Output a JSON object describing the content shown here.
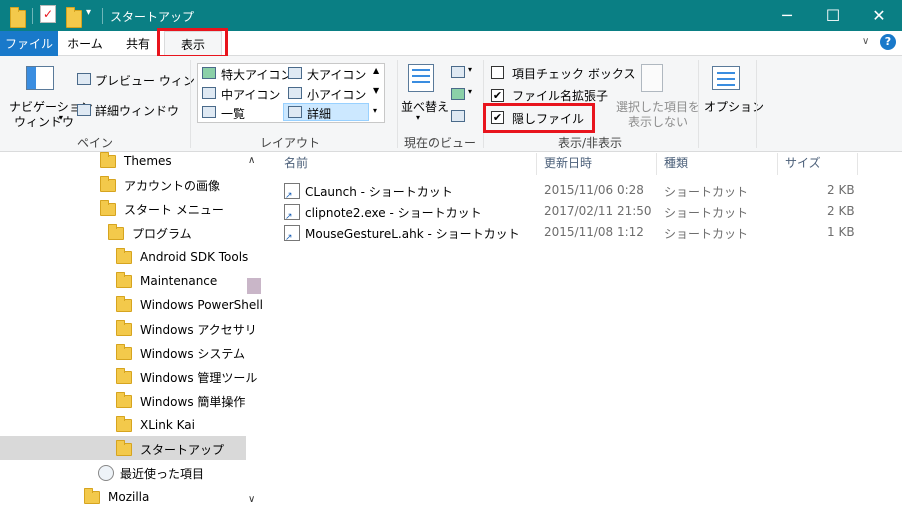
{
  "window": {
    "title": "スタートアップ",
    "controls": {
      "minimize": "─",
      "maximize": "☐",
      "close": "✕"
    }
  },
  "tabs": [
    {
      "label": "ファイル"
    },
    {
      "label": "ホーム"
    },
    {
      "label": "共有"
    },
    {
      "label": "表示"
    }
  ],
  "ribbon": {
    "panes": {
      "nav_pane_l1": "ナビゲーション",
      "nav_pane_l2": "ウィンドウ",
      "preview": "プレビュー ウィンドウ",
      "details": "詳細ウィンドウ",
      "label": "ペイン"
    },
    "layout": {
      "items": [
        "特大アイコン",
        "大アイコン",
        "中アイコン",
        "小アイコン",
        "一覧",
        "詳細"
      ],
      "selected": "詳細",
      "label": "レイアウト"
    },
    "current_view": {
      "sort_label": "並べ替え",
      "label": "現在のビュー"
    },
    "show_hide": {
      "item_checkboxes": {
        "label": "項目チェック ボックス",
        "checked": false
      },
      "extensions": {
        "label": "ファイル名拡張子",
        "checked": true
      },
      "hidden_items": {
        "label": "隠しファイル",
        "checked": true
      },
      "hide_selected_l1": "選択した項目を",
      "hide_selected_l2": "表示しない",
      "label": "表示/非表示"
    },
    "options_label": "オプション"
  },
  "nav": {
    "items": [
      "Themes",
      "アカウントの画像",
      "スタート メニュー",
      "プログラム",
      "Android SDK Tools",
      "Maintenance",
      "Windows PowerShell",
      "Windows アクセサリ",
      "Windows システム ツー",
      "Windows 管理ツール",
      "Windows 簡単操作",
      "XLink Kai",
      "スタートアップ",
      "最近使った項目",
      "Mozilla"
    ],
    "selected": "スタートアップ"
  },
  "columns": [
    "名前",
    "更新日時",
    "種類",
    "サイズ"
  ],
  "files": [
    {
      "name": "CLaunch - ショートカット",
      "modified": "2015/11/06 0:28",
      "type": "ショートカット",
      "size": "2 KB"
    },
    {
      "name": "clipnote2.exe - ショートカット",
      "modified": "2017/02/11 21:50",
      "type": "ショートカット",
      "size": "2 KB"
    },
    {
      "name": "MouseGestureL.ahk - ショートカット",
      "modified": "2015/11/08 1:12",
      "type": "ショートカット",
      "size": "1 KB"
    }
  ],
  "colors": {
    "titlebar": "#0a7f84",
    "file_tab": "#1979ca",
    "highlight": "#e8141d",
    "selected_item": "#cce8ff"
  }
}
